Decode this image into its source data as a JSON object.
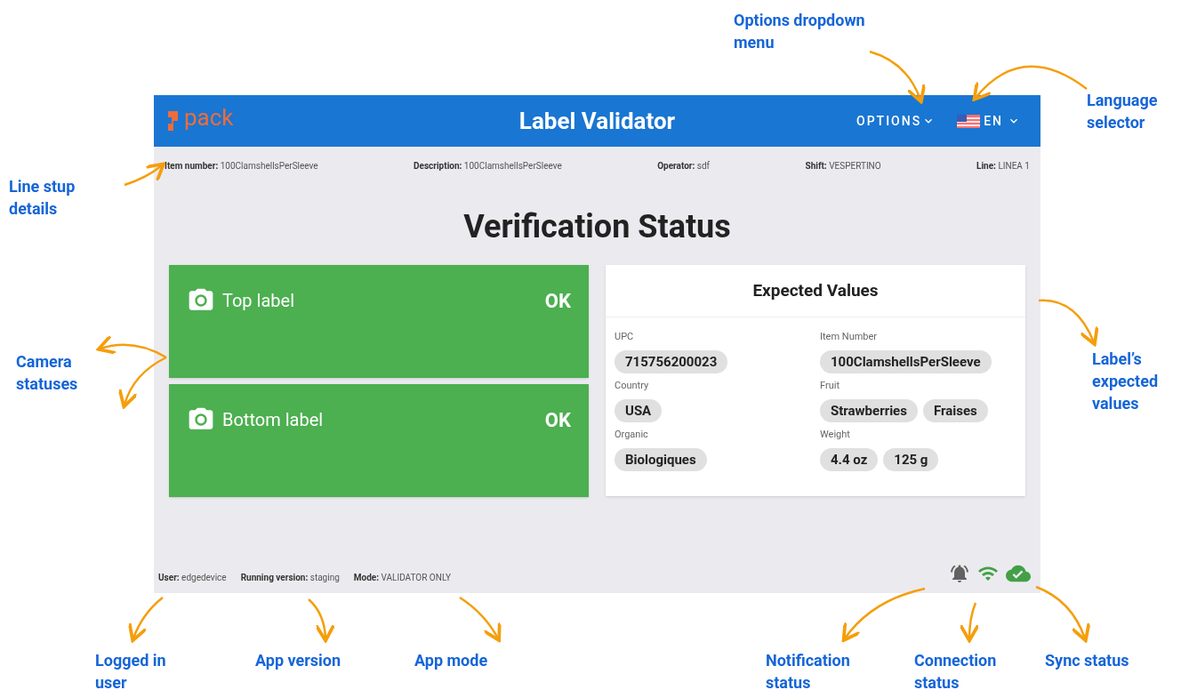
{
  "app": {
    "logo": "pack",
    "title": "Label Validator",
    "options_menu": "OPTIONS",
    "language": "EN"
  },
  "line_details": [
    {
      "label": "Item number:",
      "value": "100ClamshellsPerSleeve"
    },
    {
      "label": "Description:",
      "value": "100ClamshellsPerSleeve"
    },
    {
      "label": "Operator:",
      "value": "sdf"
    },
    {
      "label": "Shift:",
      "value": "VESPERTINO"
    },
    {
      "label": "Line:",
      "value": "LINEA 1"
    }
  ],
  "heading": "Verification Status",
  "cameras": [
    {
      "name": "Top label",
      "status": "OK",
      "kind": "ok"
    },
    {
      "name": "Bottom label",
      "status": "OK",
      "kind": "ok"
    }
  ],
  "expected_values": {
    "title": "Expected Values",
    "fields": [
      {
        "label": "UPC",
        "values": [
          "715756200023"
        ]
      },
      {
        "label": "Item Number",
        "values": [
          "100ClamshellsPerSleeve"
        ]
      },
      {
        "label": "Country",
        "values": [
          "USA"
        ]
      },
      {
        "label": "Fruit",
        "values": [
          "Strawberries",
          "Fraises"
        ]
      },
      {
        "label": "Organic",
        "values": [
          "Biologiques"
        ]
      },
      {
        "label": "Weight",
        "values": [
          "4.4 oz",
          "125 g"
        ]
      }
    ]
  },
  "footer": [
    {
      "label": "User:",
      "value": "edgedevice"
    },
    {
      "label": "Running version:",
      "value": "staging"
    },
    {
      "label": "Mode:",
      "value": "VALIDATOR ONLY"
    }
  ],
  "status_icons": [
    {
      "kind": "notification",
      "active": false
    },
    {
      "kind": "connection",
      "active": true
    },
    {
      "kind": "sync",
      "active": true
    }
  ],
  "annotations": [
    "Options dropdown menu",
    "Language selector",
    "Line stup details",
    "Camera statuses",
    "Label’s expected values",
    "Logged in user",
    "App version",
    "App mode",
    "Notification status",
    "Connection status",
    "Sync status"
  ]
}
